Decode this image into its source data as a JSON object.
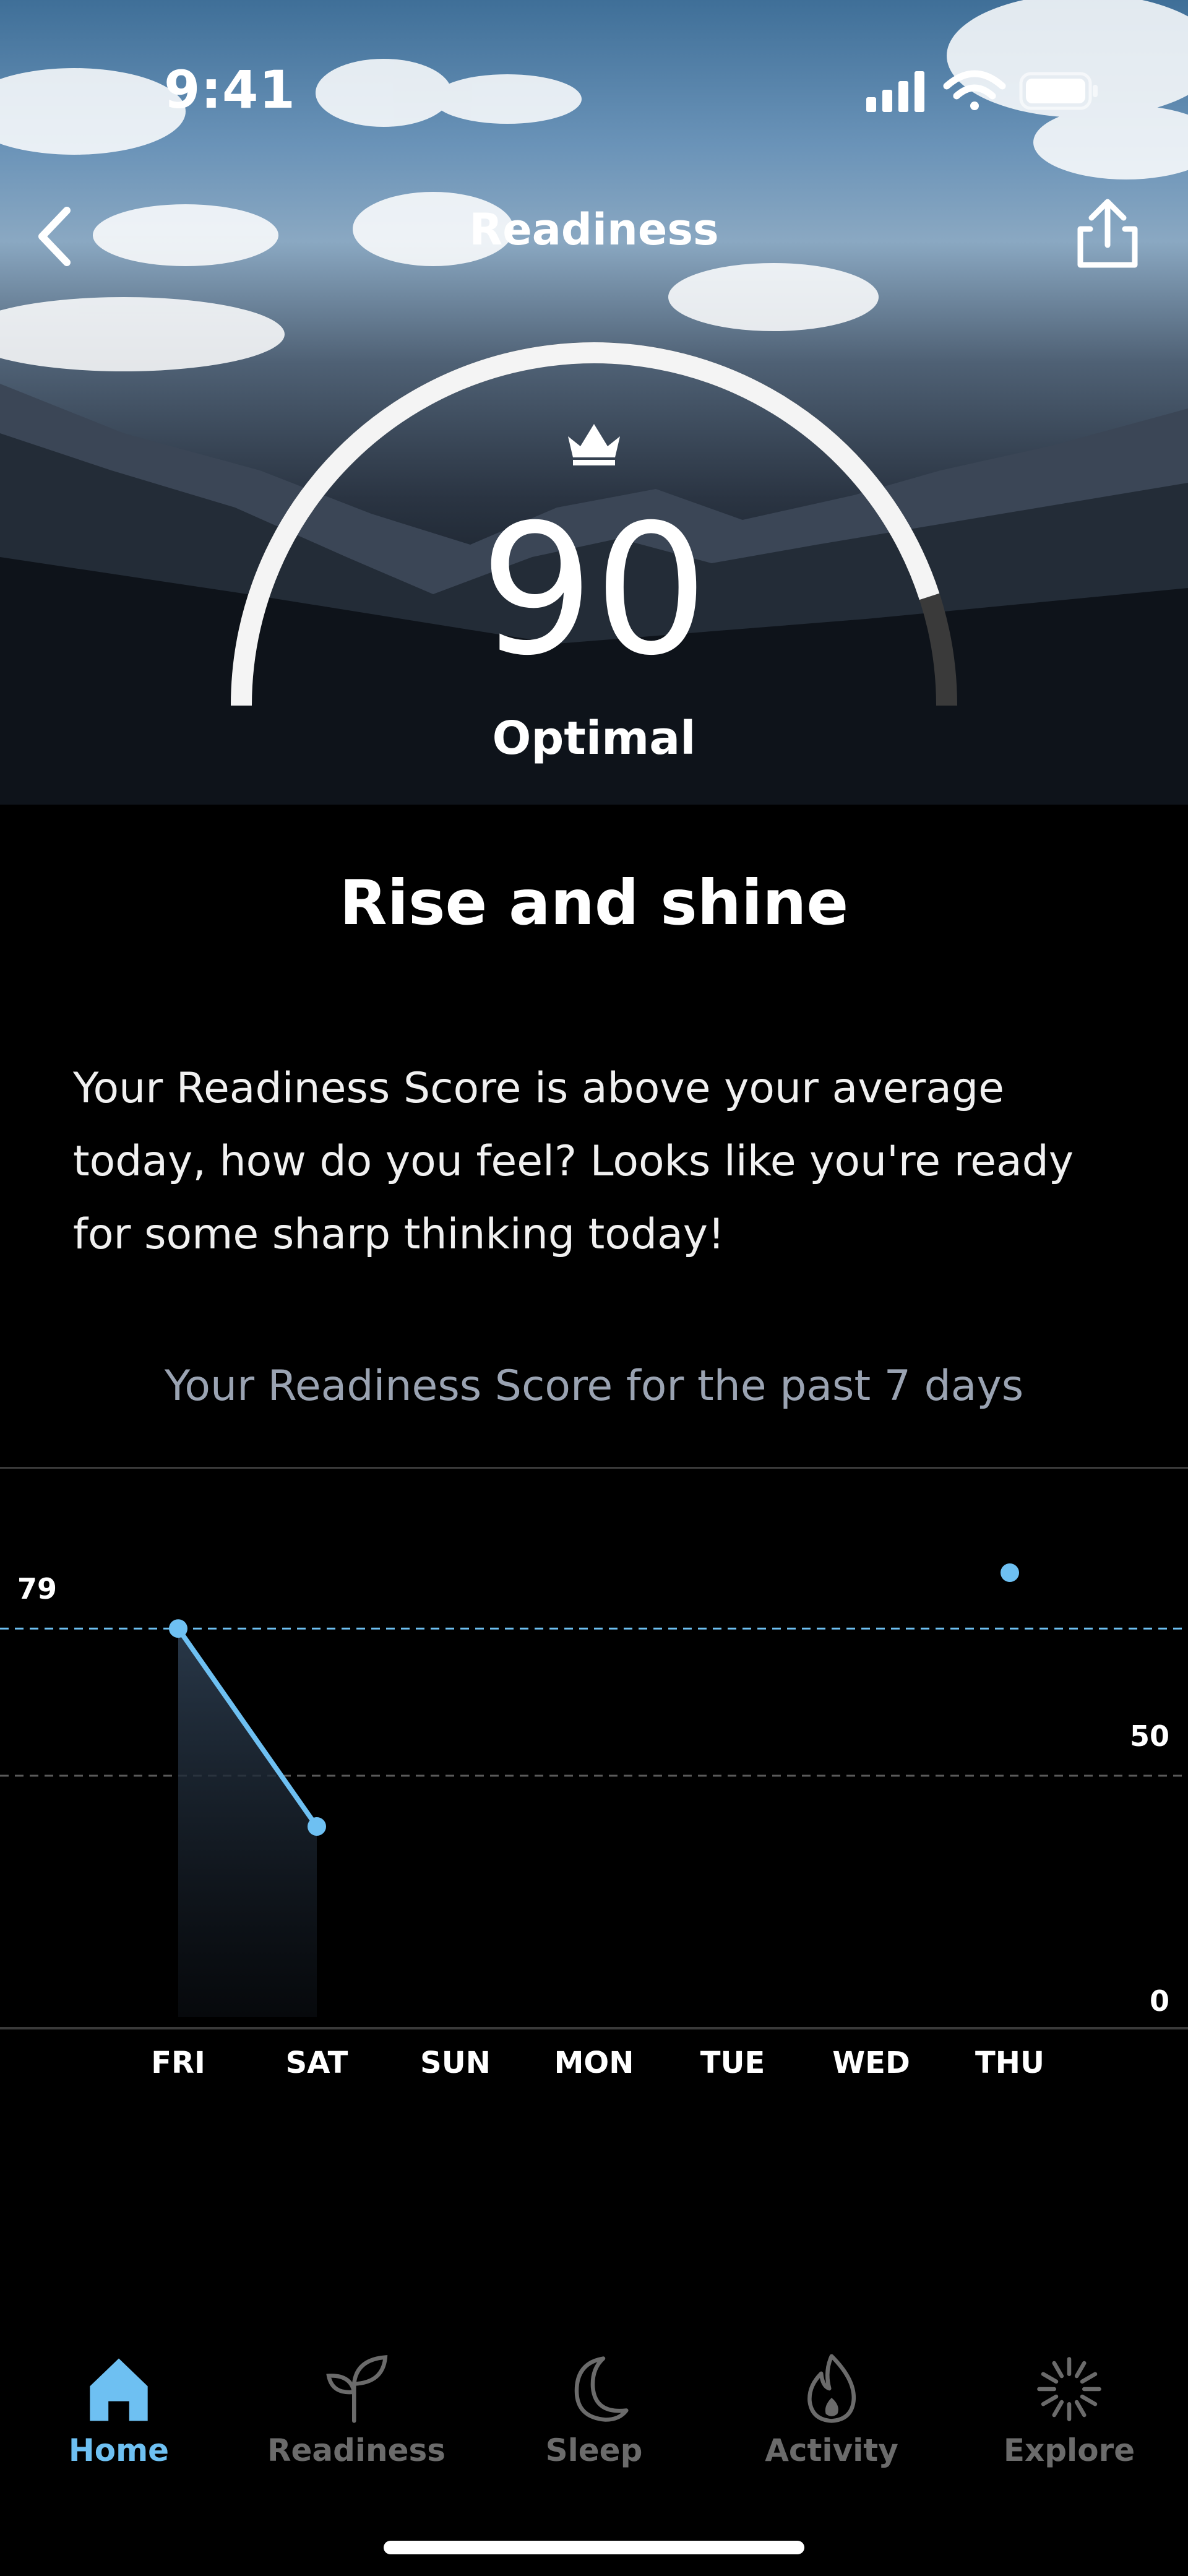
{
  "status_bar": {
    "time": "9:41"
  },
  "nav": {
    "title": "Readiness"
  },
  "score": {
    "value": "90",
    "label": "Optimal",
    "fraction": 0.9
  },
  "headline": "Rise and shine",
  "body": "Your Readiness Score is above your average today, how do you feel? Looks like you're ready for some sharp thinking today!",
  "chart_caption": "Your Readiness Score for the past 7 days",
  "chart_data": {
    "type": "line",
    "categories": [
      "FRI",
      "SAT",
      "SUN",
      "MON",
      "TUE",
      "WED",
      "THU"
    ],
    "series": [
      {
        "values": [
          79,
          40,
          null,
          null,
          null,
          null,
          90
        ]
      }
    ],
    "average": 79,
    "average_label": "79",
    "reference_label": "50",
    "zero_label": "0",
    "ylim": [
      0,
      100
    ],
    "grid": false
  },
  "tabs": [
    {
      "label": "Home",
      "icon": "home-icon",
      "active": true
    },
    {
      "label": "Readiness",
      "icon": "sprout-icon",
      "active": false
    },
    {
      "label": "Sleep",
      "icon": "moon-icon",
      "active": false
    },
    {
      "label": "Activity",
      "icon": "flame-icon",
      "active": false
    },
    {
      "label": "Explore",
      "icon": "burst-icon",
      "active": false
    }
  ],
  "colors": {
    "accent": "#6ec0f2",
    "inactive": "#6b6b6b",
    "caption": "#9aa3b2"
  }
}
